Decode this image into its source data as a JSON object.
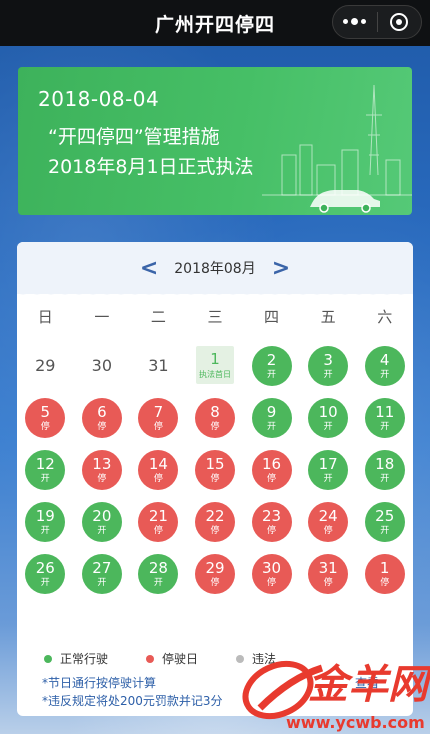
{
  "topbar": {
    "title": "广州开四停四",
    "more_icon": "more-dots-icon",
    "close_icon": "target-close-icon"
  },
  "banner": {
    "date": "2018-08-04",
    "line1": "“开四停四”管理措施",
    "line2": "2018年8月1日正式执法"
  },
  "calendar": {
    "month": "2018年08月",
    "prev": "<",
    "next": ">",
    "weekdays": [
      "日",
      "一",
      "二",
      "三",
      "四",
      "五",
      "六"
    ],
    "colors": {
      "open": "#4cb75c",
      "stop": "#e85a56",
      "violation": "#bbbbbb"
    },
    "days": [
      {
        "num": "29",
        "type": "plain",
        "tag": ""
      },
      {
        "num": "30",
        "type": "plain",
        "tag": ""
      },
      {
        "num": "31",
        "type": "plain",
        "tag": ""
      },
      {
        "num": "1",
        "type": "first",
        "tag": "执法首日"
      },
      {
        "num": "2",
        "type": "open",
        "tag": "开"
      },
      {
        "num": "3",
        "type": "open",
        "tag": "开"
      },
      {
        "num": "4",
        "type": "open",
        "tag": "开"
      },
      {
        "num": "5",
        "type": "stop",
        "tag": "停"
      },
      {
        "num": "6",
        "type": "stop",
        "tag": "停"
      },
      {
        "num": "7",
        "type": "stop",
        "tag": "停"
      },
      {
        "num": "8",
        "type": "stop",
        "tag": "停"
      },
      {
        "num": "9",
        "type": "open",
        "tag": "开"
      },
      {
        "num": "10",
        "type": "open",
        "tag": "开"
      },
      {
        "num": "11",
        "type": "open",
        "tag": "开"
      },
      {
        "num": "12",
        "type": "open",
        "tag": "开"
      },
      {
        "num": "13",
        "type": "stop",
        "tag": "停"
      },
      {
        "num": "14",
        "type": "stop",
        "tag": "停"
      },
      {
        "num": "15",
        "type": "stop",
        "tag": "停"
      },
      {
        "num": "16",
        "type": "stop",
        "tag": "停"
      },
      {
        "num": "17",
        "type": "open",
        "tag": "开"
      },
      {
        "num": "18",
        "type": "open",
        "tag": "开"
      },
      {
        "num": "19",
        "type": "open",
        "tag": "开"
      },
      {
        "num": "20",
        "type": "open",
        "tag": "开"
      },
      {
        "num": "21",
        "type": "stop",
        "tag": "停"
      },
      {
        "num": "22",
        "type": "stop",
        "tag": "停"
      },
      {
        "num": "23",
        "type": "stop",
        "tag": "停"
      },
      {
        "num": "24",
        "type": "stop",
        "tag": "停"
      },
      {
        "num": "25",
        "type": "open",
        "tag": "开"
      },
      {
        "num": "26",
        "type": "open",
        "tag": "开"
      },
      {
        "num": "27",
        "type": "open",
        "tag": "开"
      },
      {
        "num": "28",
        "type": "open",
        "tag": "开"
      },
      {
        "num": "29",
        "type": "stop",
        "tag": "停"
      },
      {
        "num": "30",
        "type": "stop",
        "tag": "停"
      },
      {
        "num": "31",
        "type": "stop",
        "tag": "停"
      },
      {
        "num": "1",
        "type": "stop",
        "tag": "停"
      }
    ]
  },
  "legend": [
    {
      "label": "正常行驶",
      "color": "#4cb75c"
    },
    {
      "label": "停驶日",
      "color": "#e85a56"
    },
    {
      "label": "违法",
      "color": "#bbbbbb"
    }
  ],
  "notes": {
    "line1": "*节日通行按停驶计算",
    "line2": "*违反规定将处200元罚款并记3分",
    "check": "查看"
  },
  "watermark": {
    "brand": "金羊网",
    "url": "www.ycwb.com"
  }
}
